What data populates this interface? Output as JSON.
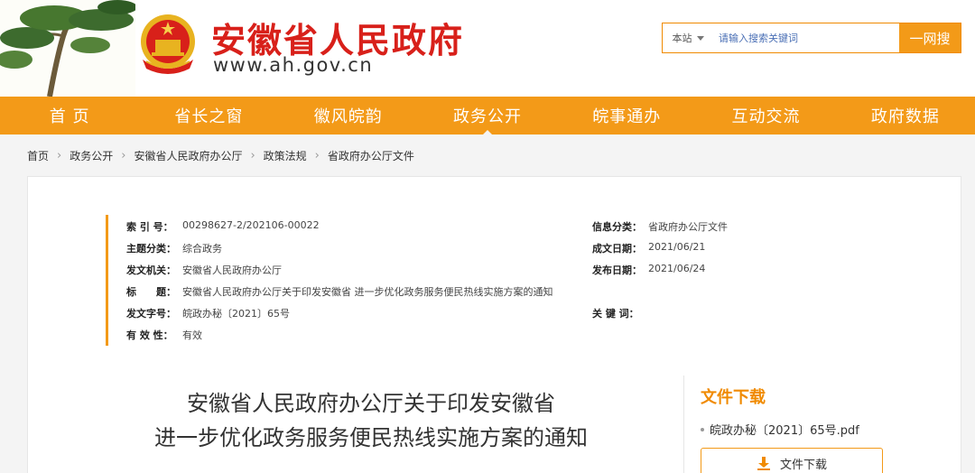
{
  "header": {
    "site_title": "安徽省人民政府",
    "site_url": "www.ah.gov.cn"
  },
  "search": {
    "scope": "本站",
    "placeholder": "请输入搜索关键词",
    "button": "一网搜"
  },
  "nav": {
    "items": [
      "首 页",
      "省长之窗",
      "徽风皖韵",
      "政务公开",
      "皖事通办",
      "互动交流",
      "政府数据"
    ],
    "active_index": 3
  },
  "breadcrumb": [
    "首页",
    "政务公开",
    "安徽省人民政府办公厅",
    "政策法规",
    "省政府办公厅文件"
  ],
  "meta": {
    "index_label": "索 引 号：",
    "index_value": "00298627-2/202106-00022",
    "category_label": "信息分类：",
    "category_value": "省政府办公厅文件",
    "topic_label": "主题分类：",
    "topic_value": "综合政务",
    "written_label": "成文日期：",
    "written_value": "2021/06/21",
    "issuer_label": "发文机关：",
    "issuer_value": "安徽省人民政府办公厅",
    "published_label": "发布日期：",
    "published_value": "2021/06/24",
    "title_label": "标　　题：",
    "title_value": "安徽省人民政府办公厅关于印发安徽省 进一步优化政务服务便民热线实施方案的通知",
    "docno_label": "发文字号：",
    "docno_value": "皖政办秘〔2021〕65号",
    "keywords_label": "关 键 词：",
    "keywords_value": "",
    "validity_label": "有 效 性：",
    "validity_value": "有效"
  },
  "document": {
    "title_line1": "安徽省人民政府办公厅关于印发安徽省",
    "title_line2": "进一步优化政务服务便民热线实施方案的通知"
  },
  "downloads": {
    "heading": "文件下载",
    "file_name": "皖政办秘〔2021〕65号.pdf",
    "button": "文件下载"
  },
  "colors": {
    "brand_red": "#d8201a",
    "accent_orange": "#f39a18"
  }
}
